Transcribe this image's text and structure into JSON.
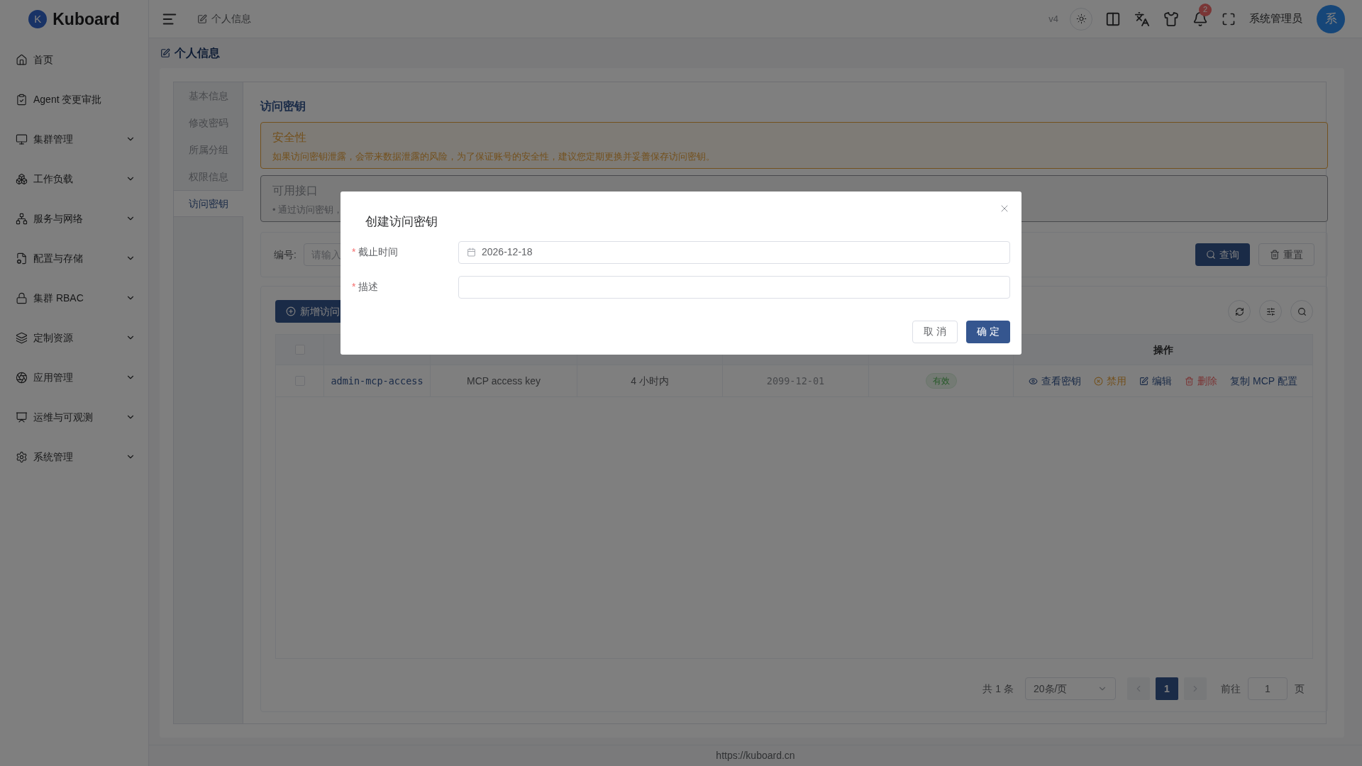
{
  "brand": {
    "name": "Kuboard",
    "logo_letter": "K"
  },
  "header": {
    "breadcrumb": "个人信息",
    "version": "v4",
    "notifications": "2",
    "user": "系统管理员",
    "avatar": "系"
  },
  "sidebar": {
    "items": [
      {
        "label": "首页",
        "expandable": false
      },
      {
        "label": "Agent 变更审批",
        "expandable": false
      },
      {
        "label": "集群管理",
        "expandable": true
      },
      {
        "label": "工作负载",
        "expandable": true
      },
      {
        "label": "服务与网络",
        "expandable": true
      },
      {
        "label": "配置与存储",
        "expandable": true
      },
      {
        "label": "集群 RBAC",
        "expandable": true
      },
      {
        "label": "定制资源",
        "expandable": true
      },
      {
        "label": "应用管理",
        "expandable": true
      },
      {
        "label": "运维与可观测",
        "expandable": true
      },
      {
        "label": "系统管理",
        "expandable": true
      }
    ]
  },
  "page_title": "个人信息",
  "profile_tabs": [
    {
      "label": "基本信息",
      "selected": false
    },
    {
      "label": "修改密码",
      "selected": false
    },
    {
      "label": "所属分组",
      "selected": false
    },
    {
      "label": "权限信息",
      "selected": false
    },
    {
      "label": "访问密钥",
      "selected": true
    }
  ],
  "section_title": "访问密钥",
  "alerts": [
    {
      "kind": "warning",
      "title": "安全性",
      "text": "如果访问密钥泄露，会带来数据泄露的风险，为了保证账号的安全性，建议您定期更换并妥善保存访问密钥。"
    },
    {
      "kind": "info",
      "title": "可用接口",
      "bullet": "•",
      "text": "通过访问密钥，"
    }
  ],
  "search": {
    "label": "编号:",
    "placeholder": "请输入",
    "buttons": [
      {
        "kind": "primary",
        "label": "查询"
      },
      {
        "kind": "secondary",
        "label": "重置"
      }
    ]
  },
  "toolbar": {
    "add_button": "新增访问"
  },
  "table": {
    "actions_header": "操作",
    "header_checked": false,
    "rows": [
      {
        "checked": false,
        "id": "admin-mcp-access",
        "description": "MCP access key",
        "created": "4 小时内",
        "expires": "2099-12-01",
        "status": "有效",
        "actions": [
          {
            "kind": "view",
            "label": "查看密钥"
          },
          {
            "kind": "disable",
            "label": "禁用"
          },
          {
            "kind": "edit",
            "label": "编辑"
          },
          {
            "kind": "delete",
            "label": "删除"
          },
          {
            "kind": "copy",
            "label": "复制 MCP 配置"
          }
        ]
      }
    ]
  },
  "pagination": {
    "total": "共 1 条",
    "page_size": "20条/页",
    "pages": [
      {
        "label": "1",
        "selected": true
      }
    ],
    "goto_label": "前往",
    "goto_value": "1",
    "goto_suffix": "页"
  },
  "footer": "https://kuboard.cn",
  "dialog": {
    "title": "创建访问密钥",
    "required_mark": "*",
    "fields": [
      {
        "kind": "date",
        "label": "截止时间",
        "required": true,
        "value": "2026-12-18"
      },
      {
        "kind": "text",
        "label": "描述",
        "required": true
      }
    ],
    "buttons": [
      {
        "kind": "secondary",
        "label": "取 消"
      },
      {
        "kind": "primary",
        "label": "确 定"
      }
    ]
  }
}
